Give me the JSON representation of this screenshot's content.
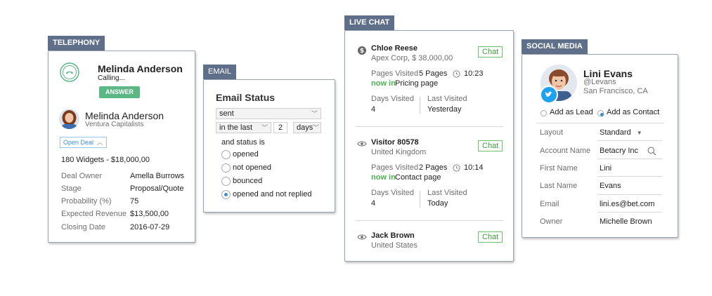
{
  "telephony": {
    "tab": "TELEPHONY",
    "caller_name": "Melinda Anderson",
    "calling_status": "Calling...",
    "answer_label": "ANSWER",
    "contact_name": "Melinda Anderson",
    "company": "Ventura Capitalists",
    "open_deal_label": "Open Deal",
    "deal_summary": "180 Widgets - $18,000,00",
    "fields": [
      {
        "label": "Deal Owner",
        "value": "Amella Burrows"
      },
      {
        "label": "Stage",
        "value": "Proposal/Quote"
      },
      {
        "label": "Probability (%)",
        "value": "75"
      },
      {
        "label": "Expected Revenue",
        "value": "$13,500,00"
      },
      {
        "label": "Closing Date",
        "value": "2016-07-29"
      }
    ]
  },
  "email": {
    "tab": "EMAIL",
    "title": "Email Status",
    "status_select": "sent",
    "range_select": "in the last",
    "range_number": "2",
    "unit_select": "days",
    "and_status_label": "and status is",
    "options": [
      "opened",
      "not opened",
      "bounced",
      "opened and not replied"
    ],
    "selected_option": "opened and not replied"
  },
  "live_chat": {
    "tab": "LIVE CHAT",
    "chat_label": "Chat",
    "visitors": [
      {
        "name": "Chloe Reese",
        "subtitle": "Apex Corp, $ 38,000,00",
        "pages_label": "Pages Visited",
        "pages_value": "5 Pages",
        "time": "10:23",
        "now_in": "now in",
        "now_page": "Pricing page",
        "days_label": "Days Visited",
        "days_value": "4",
        "last_label": "Last Visited",
        "last_value": "Yesterday"
      },
      {
        "name": "Visitor 80578",
        "subtitle": "United Kingdom",
        "pages_label": "Pages Visited",
        "pages_value": "2 Pages",
        "time": "10:14",
        "now_in": "now in",
        "now_page": "Contact page",
        "days_label": "Days Visited",
        "days_value": "4",
        "last_label": "Last Visited",
        "last_value": "Today"
      },
      {
        "name": "Jack Brown",
        "subtitle": "United States"
      }
    ]
  },
  "social": {
    "tab": "SOCIAL MEDIA",
    "name": "Lini Evans",
    "handle": "@Levans",
    "location": "San Francisco, CA",
    "add_lead": "Add as Lead",
    "add_contact": "Add as Contact",
    "fields": [
      {
        "label": "Layout",
        "value": "Standard"
      },
      {
        "label": "Account Name",
        "value": "Betacry Inc"
      },
      {
        "label": "First Name",
        "value": "Lini"
      },
      {
        "label": "Last Name",
        "value": "Evans"
      },
      {
        "label": "Email",
        "value": "lini.es@bet.com"
      },
      {
        "label": "Owner",
        "value": "Michelle Brown"
      }
    ]
  },
  "colors": {
    "tab": "#5f6f89",
    "answer": "#5bb884",
    "chat": "#3e9c3e",
    "now_in": "#4caf50",
    "twitter": "#1da1f2"
  }
}
